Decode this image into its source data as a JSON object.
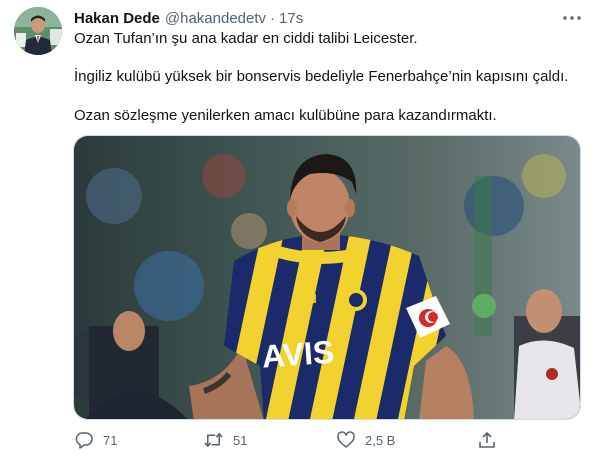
{
  "user": {
    "display_name": "Hakan Dede",
    "handle": "@hakandedetv",
    "separator": "·",
    "time": "17s"
  },
  "tweet": {
    "paragraphs": [
      "Ozan Tufan’ın şu ana kadar en ciddi talibi Leicester.",
      "İngiliz kulübü yüksek bir bonservis bedeliyle Fenerbahçe’nin kapısını çaldı.",
      "Ozan sözleşme yenilerken amacı kulübüne para kazandırmaktı."
    ],
    "media": {
      "jersey_text": "AVIS"
    }
  },
  "actions": {
    "reply_count": "71",
    "retweet_count": "51",
    "like_count": "2,5 B",
    "share_count": ""
  },
  "icons": {
    "more": "more-icon",
    "reply": "reply-icon",
    "retweet": "retweet-icon",
    "like": "like-icon",
    "share": "share-icon"
  },
  "colors": {
    "text": "#0f1419",
    "secondary": "#536471",
    "jersey_navy": "#1b2a6b",
    "jersey_yellow": "#f2d22e"
  }
}
